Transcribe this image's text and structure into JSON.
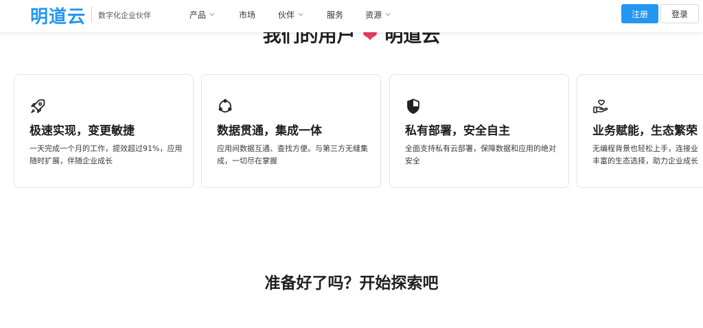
{
  "header": {
    "logo_text": "明道云",
    "slogan": "数字化企业伙伴",
    "nav": [
      {
        "label": "产品",
        "has_dropdown": true
      },
      {
        "label": "市场",
        "has_dropdown": false
      },
      {
        "label": "伙伴",
        "has_dropdown": true
      },
      {
        "label": "服务",
        "has_dropdown": false
      },
      {
        "label": "资源",
        "has_dropdown": true
      }
    ],
    "register_label": "注册",
    "login_label": "登录"
  },
  "section_heading": {
    "left": "我们的用户",
    "right": "明道云"
  },
  "features": [
    {
      "icon": "rocket-icon",
      "title": "极速实现，变更敏捷",
      "desc": "一天完成一个月的工作，提效超过91%，应用随时扩展，伴随企业成长"
    },
    {
      "icon": "integration-cycle-icon",
      "title": "数据贯通，集成一体",
      "desc": "应用间数据互通、查找方便。与第三方无缝集成，一切尽在掌握"
    },
    {
      "icon": "shield-icon",
      "title": "私有部署，安全自主",
      "desc": "全面支持私有云部署，保障数据和应用的绝对安全"
    },
    {
      "icon": "hand-heart-icon",
      "title": "业务赋能，生态繁荣",
      "desc_line1": "无编程背景也轻松上手，连接业",
      "desc_line2": "丰富的生态选择，助力企业成长"
    }
  ],
  "cta": {
    "text": "准备好了吗？开始探索吧"
  },
  "colors": {
    "brand": "#2196f3",
    "heart": "#e8395f"
  }
}
